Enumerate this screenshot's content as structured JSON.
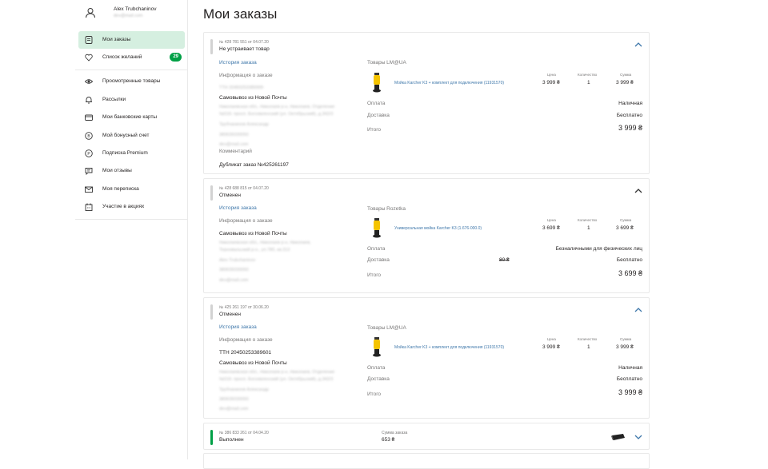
{
  "user": {
    "name": "Alex Trubchaninov",
    "email": "dev@mail.com"
  },
  "sidebar": {
    "items": [
      {
        "label": "Мои заказы"
      },
      {
        "label": "Список желаний",
        "count": "29"
      },
      {
        "label": "Просмотренные товары"
      },
      {
        "label": "Рассылки"
      },
      {
        "label": "Мои банковские карты"
      },
      {
        "label": "Мой бонусный счет"
      },
      {
        "label": "Подписка Premium"
      },
      {
        "label": "Мои отзывы"
      },
      {
        "label": "Моя переписка"
      },
      {
        "label": "Участие в акциях"
      }
    ]
  },
  "page": {
    "title": "Мои заказы"
  },
  "orders": [
    {
      "number": "№ 428 781 551 от 04.07.20",
      "status": "Не устраивает товар",
      "history_link": "История заказа",
      "info_label": "Информация о заказе",
      "ttn": "ТТН 20450253389999",
      "delivery_method": "Самовывоз из Новой Почты",
      "address_line1": "Николаевская обл., Николаев р-н, Николаев, Отделение",
      "address_line2": "№016: просп. Богоявленский (ул. Октябрьский), д.342/3",
      "recipient": "Трубчанинов Александр",
      "phone": "380635030050",
      "email": "dev@mail.com",
      "comment_label": "Комментарий",
      "duplicate": "Дубликат заказ №425261197",
      "seller": "Товары LM@UA",
      "product_name": "Мойка Karcher K3 + комплект для подключения (11931570)",
      "price_label": "Цена",
      "qty_label": "Количество",
      "sum_label": "Сумма",
      "price": "3 999 ₴",
      "qty": "1",
      "sum": "3 999 ₴",
      "payment_label": "Оплата",
      "payment": "Наличная",
      "delivery_label": "Доставка",
      "delivery": "Бесплатно",
      "total_label": "Итого",
      "total": "3 999 ₴"
    },
    {
      "number": "№ 428 688 815 от 04.07.20",
      "status": "Отменен",
      "history_link": "История заказа",
      "info_label": "Информация о заказе",
      "delivery_method": "Самовывоз из Новой Почты",
      "address_line1": "Николаевская обл., Николаев р-н, Николаев,",
      "address_line2": "Терновальский р-н., ул.78б, кв.313",
      "recipient": "Alex Trubchaninov",
      "phone": "380635030050",
      "email": "dev@mail.com",
      "seller": "Товары Rozetka",
      "product_name": "Универсальная мойка Karcher K3 (1.676-000.0)",
      "price_label": "Цена",
      "qty_label": "Количество",
      "sum_label": "Сумма",
      "price": "3 699 ₴",
      "qty": "1",
      "sum": "3 699 ₴",
      "payment_label": "Оплата",
      "payment": "Безналичными для физических лиц",
      "delivery_label": "Доставка",
      "delivery_old": "80 ₴",
      "delivery": "Бесплатно",
      "total_label": "Итого",
      "total": "3 699 ₴"
    },
    {
      "number": "№ 425 261 197 от 30.06.20",
      "status": "Отменен",
      "history_link": "История заказа",
      "info_label": "Информация о заказе",
      "ttn": "ТТН 20450253389601",
      "delivery_method": "Самовывоз из Новой Почты",
      "address_line1": "Николаевская обл., Николаев р-н, Николаев, Отделение",
      "address_line2": "№016: просп. Богоявленский (ул. Октябрьский), д.342/3",
      "recipient": "Трубчанинов Александр",
      "phone": "380635030050",
      "email": "dev@mail.com",
      "seller": "Товары LM@UA",
      "product_name": "Мойка Karcher K3 + комплект для подключения (11931570)",
      "price_label": "Цена",
      "qty_label": "Количество",
      "sum_label": "Сумма",
      "price": "3 999 ₴",
      "qty": "1",
      "sum": "3 999 ₴",
      "payment_label": "Оплата",
      "payment": "Наличная",
      "delivery_label": "Доставка",
      "delivery": "Бесплатно",
      "total_label": "Итого",
      "total": "3 999 ₴"
    },
    {
      "number": "№ 386 833 261 от 04.04.20",
      "status": "Выполнен",
      "sum_label": "Сумма заказа",
      "sum": "653 ₴"
    }
  ],
  "colors": {
    "accent": "#00a046",
    "link": "#3e77aa",
    "active_bg": "#d5efe0",
    "muted": "#797878"
  },
  "icons": [
    "user-icon",
    "orders-icon",
    "heart-icon",
    "eye-icon",
    "bell-icon",
    "card-icon",
    "bonus-icon",
    "premium-icon",
    "reviews-icon",
    "mail-icon",
    "calendar-icon",
    "chevron-up-icon",
    "chevron-down-icon"
  ]
}
